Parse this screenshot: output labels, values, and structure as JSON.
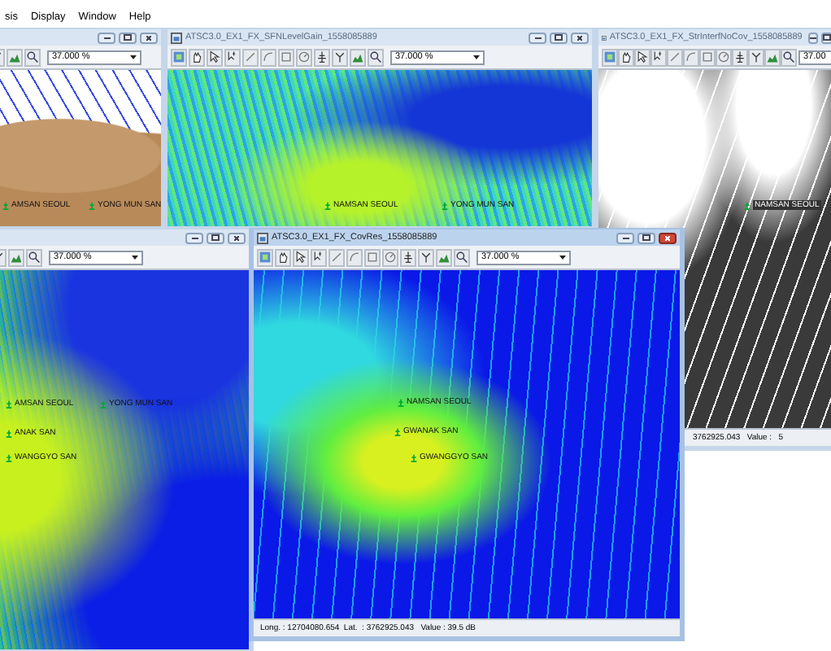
{
  "menu_bar": {
    "items": [
      "sis",
      "Display",
      "Window",
      "Help"
    ]
  },
  "windows": [
    {
      "active": false,
      "zoom": "37.000 %",
      "kind": "brown",
      "labels": [
        "AMSAN SEOUL",
        "YONG MUN SAN"
      ]
    },
    {
      "title": "ATSC3.0_EX1_FX_SFNLevelGain_1558085889",
      "active": false,
      "zoom": "37.000 %",
      "kind": "gain",
      "labels": [
        "NAMSAN SEOUL",
        "YONG MUN SAN"
      ]
    },
    {
      "title": "ATSC3.0_EX1_FX_StrInterfNoCov_1558085889",
      "active": false,
      "zoom": "37.00",
      "kind": "binary",
      "labels": [
        "NAMSAN SEOUL"
      ],
      "status": "3762925.043   Value :   5"
    },
    {
      "active": false,
      "zoom": "37.000 %",
      "kind": "coverage",
      "labels": [
        "AMSAN SEOUL",
        "YONG MUN SAN",
        "ANAK SAN",
        "WANGGYO SAN"
      ]
    },
    {
      "title": "ATSC3.0_EX1_FX_CovRes_1558085889",
      "active": true,
      "zoom": "37.000 %",
      "kind": "deep",
      "labels": [
        "NAMSAN SEOUL",
        "GWANAK SAN",
        "GWANGGYO SAN"
      ],
      "status": "Long. : 12704080.654  Lat.  : 3762925.043   Value : 39.5 dB"
    }
  ]
}
